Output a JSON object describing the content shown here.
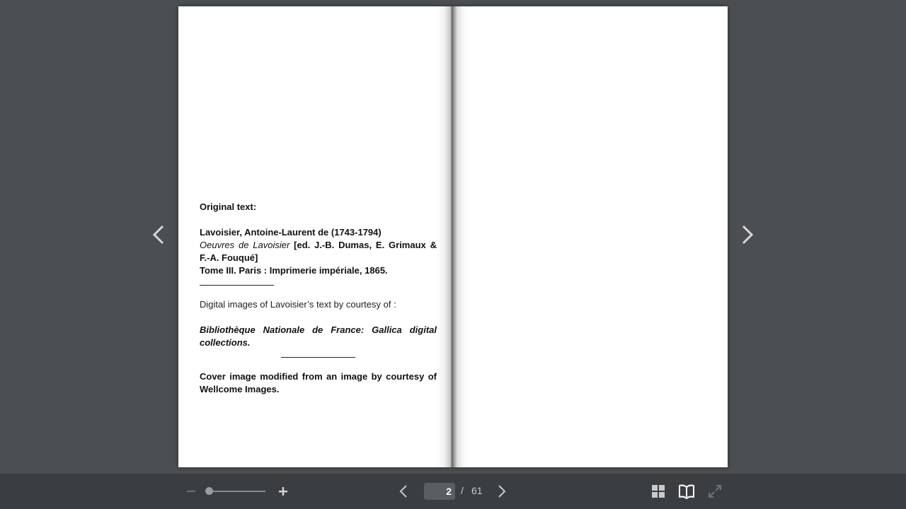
{
  "document": {
    "left_page": {
      "heading": "Original text:",
      "author_line": "Lavoisier, Antoine-Laurent de (1743-1794)",
      "work_title": "Oeuvres de Lavoisier",
      "editors": " [ed. J.-B. Dumas, E. Grimaux & F.-A. Fouqué]",
      "publication": "Tome III. Paris : Imprimerie impériale, 1865.",
      "courtesy_line": "Digital images of Lavoisier’s text by courtesy of :",
      "library": "Bibliothèque Nationale de France: Gallica digital collections.",
      "cover_credit": "Cover image modified from an image by courtesy of Wellcome Images."
    }
  },
  "toolbar": {
    "current_page": "2",
    "separator": "/",
    "total_pages": "61"
  },
  "icons": {
    "prev_arrow": "chevron-left-icon",
    "next_arrow": "chevron-right-icon",
    "zoom_out": "minus-icon",
    "zoom_in": "plus-icon",
    "thumbnails": "grid-icon",
    "book_view": "open-book-icon",
    "fullscreen": "expand-icon"
  },
  "colors": {
    "background": "#4b4f52",
    "toolbar": "#3b3e41",
    "icon_active": "#e6e7e8",
    "icon_muted": "#8a8d90"
  }
}
